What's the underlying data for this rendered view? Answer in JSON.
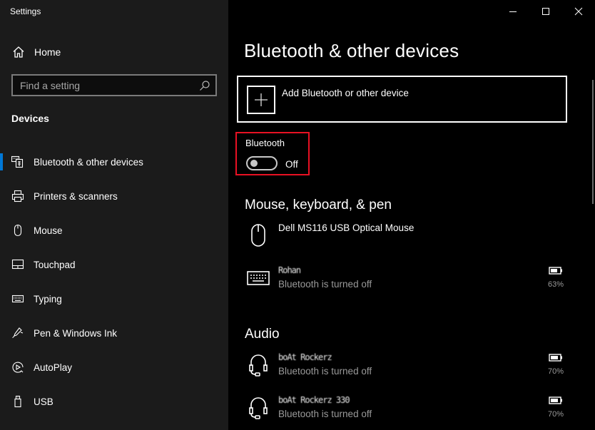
{
  "window": {
    "title": "Settings",
    "controls": {
      "minimize": "minimize-icon",
      "maximize": "maximize-icon",
      "close": "close-icon"
    }
  },
  "sidebar": {
    "home_label": "Home",
    "search_placeholder": "Find a setting",
    "search_value": "",
    "section_title": "Devices",
    "items": [
      {
        "label": "Bluetooth & other devices",
        "icon": "bluetooth-devices-icon",
        "active": true
      },
      {
        "label": "Printers & scanners",
        "icon": "printer-icon",
        "active": false
      },
      {
        "label": "Mouse",
        "icon": "mouse-icon",
        "active": false
      },
      {
        "label": "Touchpad",
        "icon": "touchpad-icon",
        "active": false
      },
      {
        "label": "Typing",
        "icon": "keyboard-icon",
        "active": false
      },
      {
        "label": "Pen & Windows Ink",
        "icon": "pen-icon",
        "active": false
      },
      {
        "label": "AutoPlay",
        "icon": "autoplay-icon",
        "active": false
      },
      {
        "label": "USB",
        "icon": "usb-icon",
        "active": false
      }
    ],
    "accent_color": "#0078d7"
  },
  "main": {
    "title": "Bluetooth & other devices",
    "add_device_label": "Add Bluetooth or other device",
    "bluetooth": {
      "label": "Bluetooth",
      "state": "Off",
      "on": false,
      "highlight_color": "#e81123"
    },
    "groups": [
      {
        "title": "Mouse, keyboard, & pen",
        "devices": [
          {
            "name": "Dell MS116 USB Optical Mouse",
            "status": "",
            "icon": "mouse-icon",
            "battery": null,
            "redacted": false
          },
          {
            "name": "Rohan",
            "status": "Bluetooth is turned off",
            "icon": "keyboard-icon",
            "battery": "63%",
            "redacted": true
          }
        ]
      },
      {
        "title": "Audio",
        "devices": [
          {
            "name": "boAt Rockerz",
            "status": "Bluetooth is turned off",
            "icon": "headset-icon",
            "battery": "70%",
            "redacted": true
          },
          {
            "name": "boAt Rockerz 330",
            "status": "Bluetooth is turned off",
            "icon": "headset-icon",
            "battery": "70%",
            "redacted": true
          }
        ]
      }
    ]
  }
}
